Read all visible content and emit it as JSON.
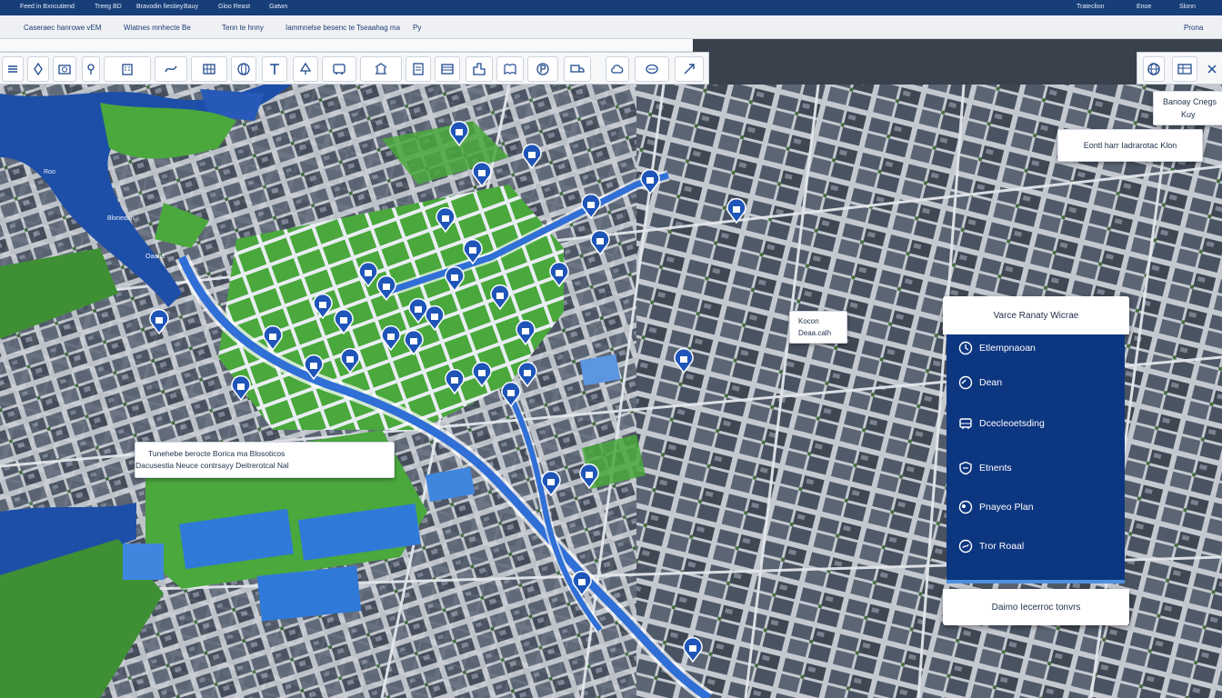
{
  "topbar": {
    "items": [
      "Feed in Bxncutiend",
      "Treeg BD",
      "Bravodin fiestiey",
      "Bauy",
      "Gloo Reast",
      "Gatwn",
      "Trateclion",
      "Enoe",
      "Slonn"
    ]
  },
  "addressbar": {
    "breadcrumbs": [
      "Caseraec hanrowe vEM",
      "Wiatnes mnhecte Be",
      "Tenn te hnny",
      "Iammnelse besenc te",
      "Tseaahag ma",
      "Py"
    ],
    "right_label": "Prona"
  },
  "toolbar": {
    "button_icons": [
      "menu-icon",
      "marker-icon",
      "camera-icon",
      "pin-icon",
      "building-icon",
      "route-icon",
      "grid-icon",
      "globe-icon",
      "text-icon",
      "tree-icon",
      "bus-icon",
      "station-icon",
      "doc-icon",
      "table-icon",
      "city-icon",
      "book-icon",
      "parking-icon",
      "truck-icon",
      "video-icon",
      "cloud-icon",
      "bus2-icon",
      "expand-icon"
    ]
  },
  "right_tools": {
    "icons": [
      "globe-icon",
      "layers-icon",
      "close-icon"
    ]
  },
  "map_labels": {
    "top_right_a": "Banoay Cnegs",
    "top_right_b": "Kuy",
    "district_label": "Eontl harr Iadrarotac Klon",
    "west_label": "Blonedon",
    "west_label2": "Oaana",
    "river_label": "Roo",
    "small_box_a": "Kocon",
    "small_box_b": "Deaa.calh",
    "info_line1": "Tunehebe berocte Borica ma Blosoticos",
    "info_line2": "Dacusestia Neuce contrsayy Deitrerotcal Nal"
  },
  "legend": {
    "title": "Varce Ranaty Wicrae",
    "items": [
      {
        "label": "Etlempnaoan",
        "icon": "clock-icon"
      },
      {
        "label": "Dean",
        "icon": "gauge-icon"
      },
      {
        "label": "Dcecleoetsding",
        "icon": "bus-icon"
      },
      {
        "label": "Etnents",
        "icon": "shield-icon"
      },
      {
        "label": "Pnayeo Plan",
        "icon": "location-icon"
      },
      {
        "label": "Tror Roaal",
        "icon": "route-icon"
      }
    ],
    "footer": "Daimo Iecerroc tonvrs"
  },
  "colors": {
    "route_blue": "#2f6fd6",
    "river_blue": "#1e4fa8",
    "park_green": "#4aa83c",
    "panel_navy": "#0d3680",
    "building_gray": "#4b5463"
  }
}
